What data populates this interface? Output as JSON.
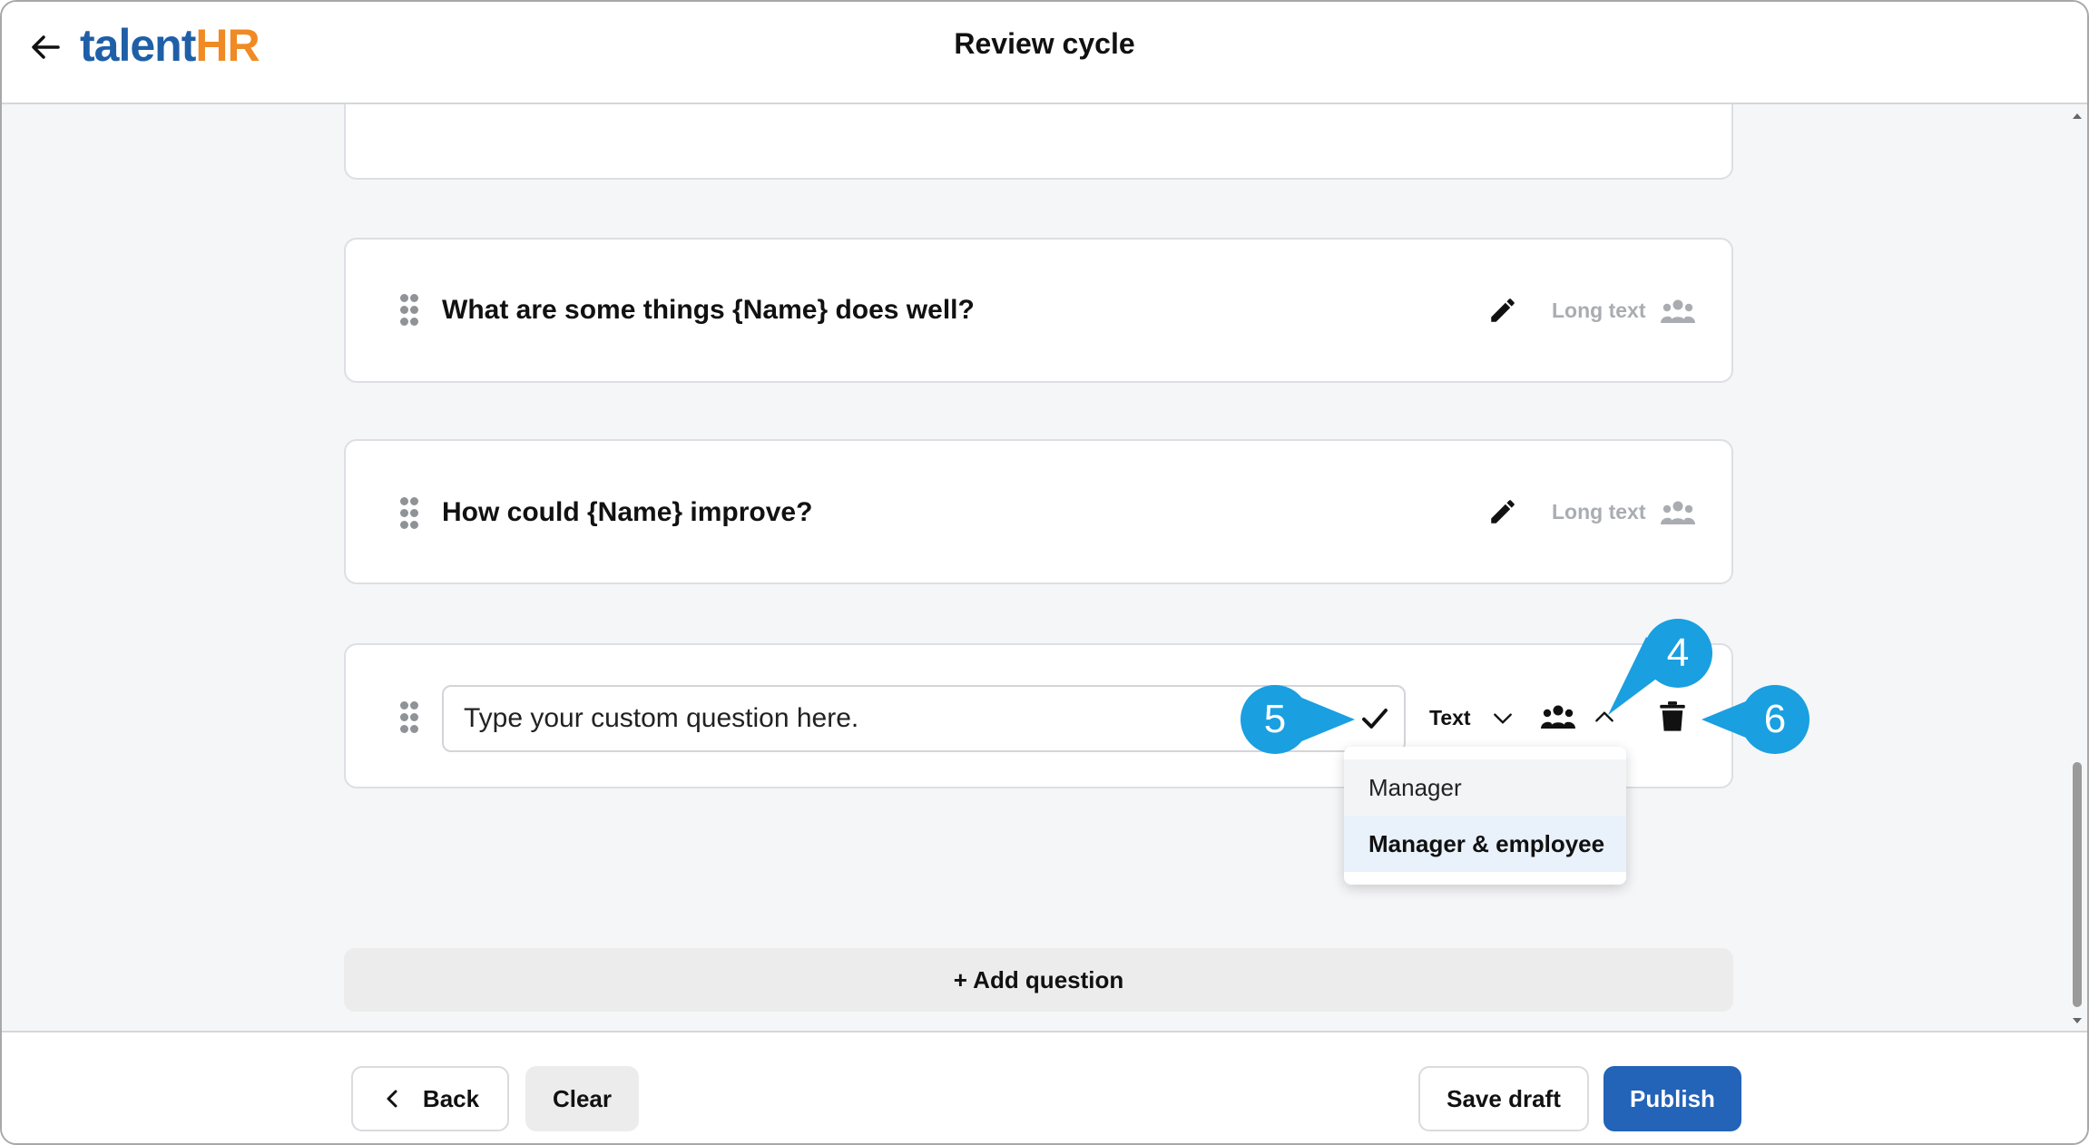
{
  "header": {
    "logo_talent": "talent",
    "logo_hr": "HR",
    "title": "Review cycle"
  },
  "questions": [
    {
      "text": "What are some things {Name} does well?",
      "type": "Long text"
    },
    {
      "text": "How could {Name} improve?",
      "type": "Long text"
    }
  ],
  "custom_question": {
    "placeholder": "Type your custom question here.",
    "type": "Text"
  },
  "visibility_dropdown": {
    "options": [
      "Manager",
      "Manager & employee"
    ],
    "selected": "Manager & employee"
  },
  "add_question_label": "+ Add question",
  "callouts": {
    "a": "4",
    "b": "5",
    "c": "6"
  },
  "footer": {
    "back": "Back",
    "clear": "Clear",
    "save_draft": "Save draft",
    "publish": "Publish"
  },
  "colors": {
    "primary": "#2363b8",
    "callout": "#1a9fe0",
    "logo_blue": "#1f5fa8",
    "logo_orange": "#f08a24"
  }
}
